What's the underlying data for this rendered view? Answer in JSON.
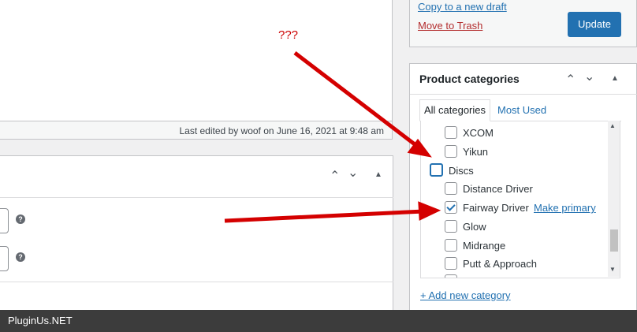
{
  "editor": {
    "last_edited": "Last edited by woof on June 16, 2021 at 9:48 am"
  },
  "publish": {
    "copy_draft": "Copy to a new draft",
    "move_trash": "Move to Trash",
    "update_label": "Update"
  },
  "categories": {
    "title": "Product categories",
    "tabs": [
      "All categories",
      "Most Used"
    ],
    "items": [
      {
        "label": "XCOM",
        "checked": false
      },
      {
        "label": "Yikun",
        "checked": false
      },
      {
        "label": "Discs",
        "checked": false
      },
      {
        "label": "Distance Driver",
        "checked": false
      },
      {
        "label": "Fairway Driver",
        "checked": true
      },
      {
        "label": "Glow",
        "checked": false
      },
      {
        "label": "Midrange",
        "checked": false
      },
      {
        "label": "Putt & Approach",
        "checked": false
      }
    ],
    "make_primary": "Make primary",
    "add_new": "+ Add new category"
  },
  "annotation": {
    "question": "???"
  },
  "footer": {
    "brand": "PluginUs.NET"
  },
  "colors": {
    "accent": "#2271b1",
    "arrow": "#d40000",
    "danger": "#b32d2e"
  }
}
